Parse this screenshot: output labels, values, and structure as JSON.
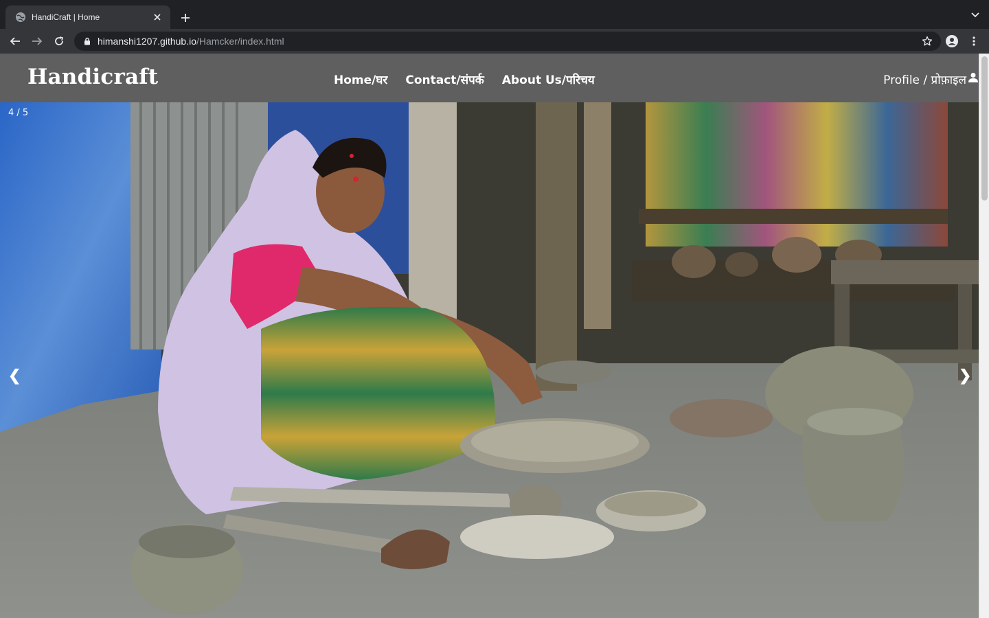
{
  "browser": {
    "tab_title": "HandiCraft | Home",
    "url_host": "himanshi1207.github.io",
    "url_path": "/Hamcker/index.html"
  },
  "site": {
    "brand": "Handicraft",
    "nav": [
      {
        "label": "Home/घर"
      },
      {
        "label": "Contact/संपर्क"
      },
      {
        "label": "About Us/परिचय"
      }
    ],
    "profile_label": "Profile / प्रोफ़ाइल"
  },
  "slideshow": {
    "counter": "4 / 5",
    "prev_label": "❮",
    "next_label": "❯",
    "image_icon": "potter-woman-photo"
  },
  "colors": {
    "chrome_dark": "#202124",
    "chrome_toolbar": "#35363a",
    "site_nav_bg": "#5f5f5f"
  }
}
